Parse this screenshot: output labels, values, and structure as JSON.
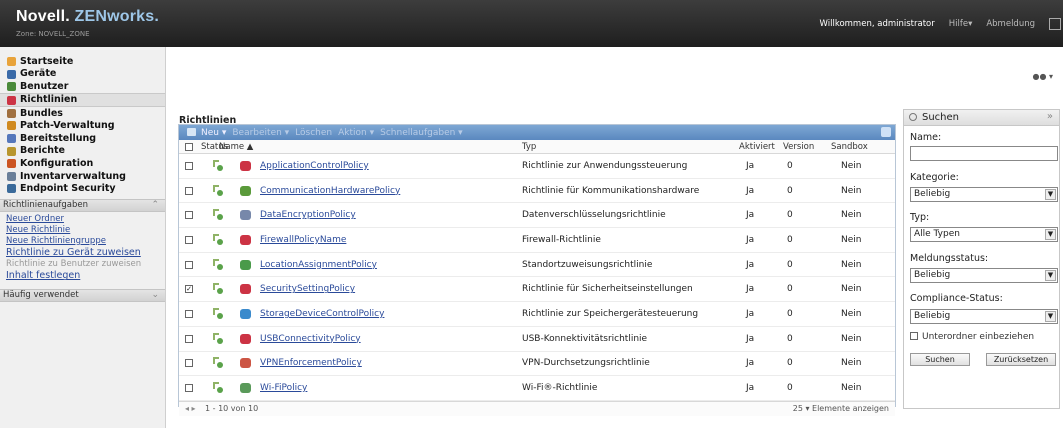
{
  "header": {
    "brand": "Novell.",
    "product": "ZENworks.",
    "zone": "Zone: NOVELL_ZONE",
    "welcome": "Willkommen, administrator",
    "help": "Hilfe▾",
    "logout": "Abmeldung"
  },
  "nav": {
    "items": [
      {
        "label": "Startseite",
        "icon": "home-icon",
        "color": "#e8a33a"
      },
      {
        "label": "Geräte",
        "icon": "device-icon",
        "color": "#3a6aa8"
      },
      {
        "label": "Benutzer",
        "icon": "users-icon",
        "color": "#4a8a3a"
      },
      {
        "label": "Richtlinien",
        "icon": "policy-icon",
        "color": "#cc3344",
        "selected": true
      },
      {
        "label": "Bundles",
        "icon": "bundle-icon",
        "color": "#a07040"
      },
      {
        "label": "Patch-Verwaltung",
        "icon": "patch-icon",
        "color": "#d08a20"
      },
      {
        "label": "Bereitstellung",
        "icon": "deploy-icon",
        "color": "#5577bb"
      },
      {
        "label": "Berichte",
        "icon": "reports-icon",
        "color": "#b8962e"
      },
      {
        "label": "Konfiguration",
        "icon": "configuration-icon",
        "color": "#cc5522"
      },
      {
        "label": "Inventarverwaltung",
        "icon": "inventory-icon",
        "color": "#6a7f99"
      },
      {
        "label": "Endpoint Security",
        "icon": "security-icon",
        "color": "#3a6a9a"
      }
    ],
    "tasks_title": "Richtlinienaufgaben",
    "tasks": [
      {
        "label": "Neuer Ordner",
        "enabled": true
      },
      {
        "label": "Neue Richtlinie",
        "enabled": true
      },
      {
        "label": "Neue Richtliniengruppe",
        "enabled": true
      },
      {
        "label": "Richtlinie zu Gerät zuweisen",
        "enabled": true,
        "big": true
      },
      {
        "label": "Richtlinie zu Benutzer zuweisen",
        "enabled": false
      },
      {
        "label": "Inhalt festlegen",
        "enabled": true,
        "big": true
      }
    ],
    "frequent_title": "Häufig verwendet"
  },
  "main": {
    "title": "Richtlinien",
    "toolbar": {
      "new": "Neu ▾",
      "edit": "Bearbeiten ▾",
      "delete": "Löschen",
      "action": "Aktion ▾",
      "quick": "Schnellaufgaben ▾"
    },
    "columns": {
      "status": "Status",
      "name": "Name ▲",
      "type": "Typ",
      "active": "Aktiviert",
      "version": "Version",
      "sandbox": "Sandbox"
    },
    "rows": [
      {
        "checked": "",
        "name": "ApplicationControlPolicy",
        "type": "Richtlinie zur Anwendungssteuerung",
        "active": "Ja",
        "version": "0",
        "sandbox": "Nein",
        "icon": "application-control-icon",
        "color": "#cc3344"
      },
      {
        "checked": "",
        "name": "CommunicationHardwarePolicy",
        "type": "Richtlinie für Kommunikationshardware",
        "active": "Ja",
        "version": "0",
        "sandbox": "Nein",
        "icon": "communication-hardware-icon",
        "color": "#5a9a3a"
      },
      {
        "checked": "",
        "name": "DataEncryptionPolicy",
        "type": "Datenverschlüsselungsrichtlinie",
        "active": "Ja",
        "version": "0",
        "sandbox": "Nein",
        "icon": "data-encryption-icon",
        "color": "#7788aa"
      },
      {
        "checked": "",
        "name": "FirewallPolicyName",
        "type": "Firewall-Richtlinie",
        "active": "Ja",
        "version": "0",
        "sandbox": "Nein",
        "icon": "firewall-icon",
        "color": "#cc3344"
      },
      {
        "checked": "",
        "name": "LocationAssignmentPolicy",
        "type": "Standortzuweisungsrichtlinie",
        "active": "Ja",
        "version": "0",
        "sandbox": "Nein",
        "icon": "location-icon",
        "color": "#4a9a4a"
      },
      {
        "checked": "✓",
        "name": "SecuritySettingPolicy",
        "type": "Richtlinie für Sicherheitseinstellungen",
        "active": "Ja",
        "version": "0",
        "sandbox": "Nein",
        "icon": "security-setting-icon",
        "color": "#cc3344"
      },
      {
        "checked": "",
        "name": "StorageDeviceControlPolicy",
        "type": "Richtlinie zur Speichergerätesteuerung",
        "active": "Ja",
        "version": "0",
        "sandbox": "Nein",
        "icon": "storage-device-icon",
        "color": "#3a8acc"
      },
      {
        "checked": "",
        "name": "USBConnectivityPolicy",
        "type": "USB-Konnektivitätsrichtlinie",
        "active": "Ja",
        "version": "0",
        "sandbox": "Nein",
        "icon": "usb-icon",
        "color": "#cc3344"
      },
      {
        "checked": "",
        "name": "VPNEnforcementPolicy",
        "type": "VPN-Durchsetzungsrichtlinie",
        "active": "Ja",
        "version": "0",
        "sandbox": "Nein",
        "icon": "vpn-icon",
        "color": "#cc5544"
      },
      {
        "checked": "",
        "name": "Wi-FiPolicy",
        "type": "Wi-Fi®-Richtlinie",
        "active": "Ja",
        "version": "0",
        "sandbox": "Nein",
        "icon": "wifi-icon",
        "color": "#5a9a5a"
      }
    ],
    "pager": {
      "count": "1 - 10 von 10",
      "per_page": "25 ▾  Elemente anzeigen"
    }
  },
  "search": {
    "title": "Suchen",
    "name_label": "Name:",
    "name_value": "",
    "category_label": "Kategorie:",
    "category_value": "Beliebig",
    "type_label": "Typ:",
    "type_value": "Alle Typen",
    "msg_label": "Meldungsstatus:",
    "msg_value": "Beliebig",
    "compliance_label": "Compliance-Status:",
    "compliance_value": "Beliebig",
    "subfolders_label": "Unterordner einbeziehen",
    "search_button": "Suchen",
    "reset_button": "Zurücksetzen"
  }
}
